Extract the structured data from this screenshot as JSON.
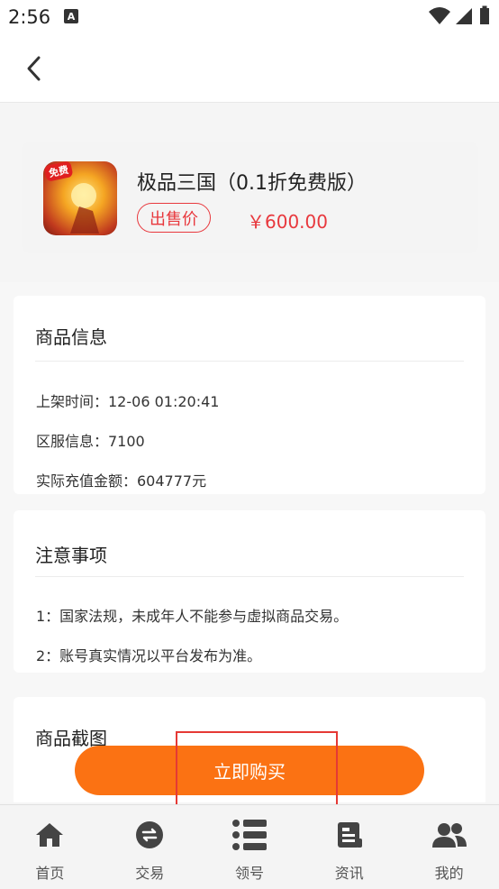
{
  "status_bar": {
    "time": "2:56",
    "notification_icon": "A"
  },
  "nav": {
    "back_icon": "chevron-left-icon"
  },
  "product": {
    "title": "极品三国（0.1折免费版）",
    "icon_badge": "免费",
    "price_label": "出售价",
    "price": "￥600.00"
  },
  "goods_info": {
    "title": "商品信息",
    "lines": [
      "上架时间：12-06 01:20:41",
      "区服信息：7100",
      "实际充值金额：604777元"
    ]
  },
  "notice": {
    "title": "注意事项",
    "lines": [
      "1：国家法规，未成年人不能参与虚拟商品交易。",
      "2：账号真实情况以平台发布为准。"
    ]
  },
  "screenshots": {
    "title": "商品截图"
  },
  "buy_button": {
    "label": "立即购买"
  },
  "tabs": [
    {
      "label": "首页",
      "icon": "home-icon"
    },
    {
      "label": "交易",
      "icon": "exchange-icon"
    },
    {
      "label": "领号",
      "icon": "list-icon"
    },
    {
      "label": "资讯",
      "icon": "news-icon"
    },
    {
      "label": "我的",
      "icon": "users-icon"
    }
  ],
  "colors": {
    "accent": "#fb7213",
    "price": "#e8383d",
    "highlight": "#e53935"
  }
}
